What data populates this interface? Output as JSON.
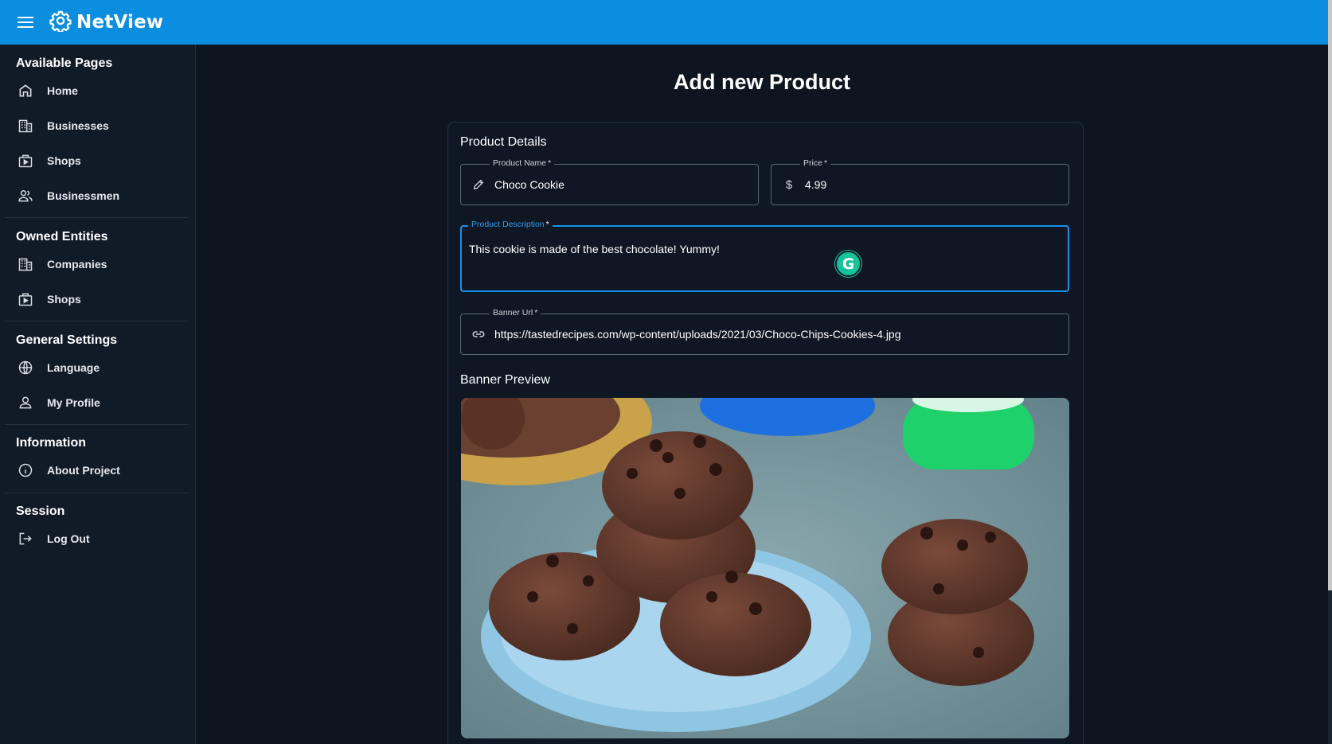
{
  "app": {
    "title": "NetView"
  },
  "sidebar": {
    "sections": [
      {
        "title": "Available Pages",
        "items": [
          {
            "label": "Home",
            "icon": "home-icon"
          },
          {
            "label": "Businesses",
            "icon": "building-icon"
          },
          {
            "label": "Shops",
            "icon": "storefront-icon"
          },
          {
            "label": "Businessmen",
            "icon": "users-icon"
          }
        ]
      },
      {
        "title": "Owned Entities",
        "items": [
          {
            "label": "Companies",
            "icon": "building-icon"
          },
          {
            "label": "Shops",
            "icon": "storefront-icon"
          }
        ]
      },
      {
        "title": "General Settings",
        "items": [
          {
            "label": "Language",
            "icon": "globe-icon"
          },
          {
            "label": "My Profile",
            "icon": "user-icon"
          }
        ]
      },
      {
        "title": "Information",
        "items": [
          {
            "label": "About Project",
            "icon": "info-icon"
          }
        ]
      },
      {
        "title": "Session",
        "items": [
          {
            "label": "Log Out",
            "icon": "logout-icon"
          }
        ]
      }
    ]
  },
  "main": {
    "page_title": "Add new Product",
    "card_title": "Product Details",
    "fields": {
      "product_name": {
        "label": "Product Name",
        "required_mark": "*",
        "value": "Choco Cookie",
        "icon": "pencil-icon"
      },
      "price": {
        "label": "Price",
        "required_mark": "*",
        "value": "4.99",
        "adornment": "$"
      },
      "description": {
        "label": "Product Description",
        "required_mark": "*",
        "value": "This cookie is made of the best chocolate! Yummy!"
      },
      "banner_url": {
        "label": "Banner Url",
        "required_mark": "*",
        "value": "https://tastedrecipes.com/wp-content/uploads/2021/03/Choco-Chips-Cookies-4.jpg",
        "icon": "link-icon"
      }
    },
    "banner_preview_title": "Banner Preview"
  },
  "colors": {
    "appbar": "#0b8de0",
    "background": "#0d1521",
    "sidebar": "#111a27",
    "focus": "#1890e8",
    "grammarly": "#15c39a"
  }
}
